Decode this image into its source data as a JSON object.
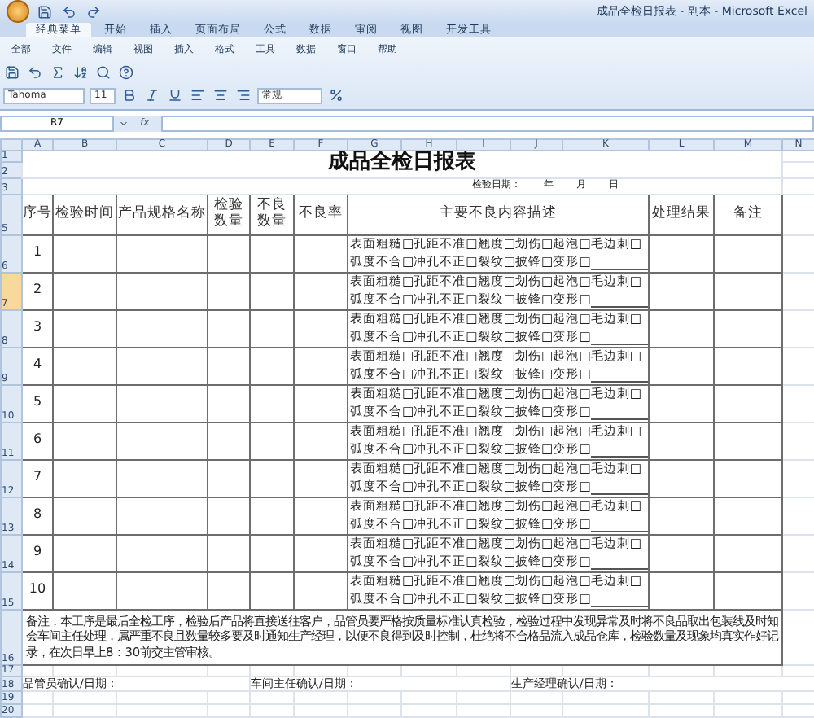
{
  "window": {
    "title": "成品全检日报表 - 副本 - Microsoft Excel"
  },
  "tabs": [
    {
      "label": "经典菜单",
      "selected": true
    },
    {
      "label": "开始",
      "selected": false
    },
    {
      "label": "插入",
      "selected": false
    },
    {
      "label": "页面布局",
      "selected": false
    },
    {
      "label": "公式",
      "selected": false
    },
    {
      "label": "数据",
      "selected": false
    },
    {
      "label": "审阅",
      "selected": false
    },
    {
      "label": "视图",
      "selected": false
    },
    {
      "label": "开发工具",
      "selected": false
    }
  ],
  "menu": [
    "全部",
    "文件",
    "编辑",
    "视图",
    "插入",
    "格式",
    "工具",
    "数据",
    "窗口",
    "帮助"
  ],
  "toolbar": {
    "font": "Tahoma",
    "size": "11",
    "number_format": "常规"
  },
  "formula_bar": {
    "name_box": "R7",
    "fx": "fx"
  },
  "columns": [
    "A",
    "B",
    "C",
    "D",
    "E",
    "F",
    "G",
    "H",
    "I",
    "J",
    "K",
    "L",
    "M",
    "N"
  ],
  "row_numbers": [
    {
      "label": "1",
      "selected": false
    },
    {
      "label": "2",
      "selected": false
    },
    {
      "label": "3",
      "selected": false
    },
    {
      "label": "5",
      "selected": false
    },
    {
      "label": "6",
      "selected": false
    },
    {
      "label": "7",
      "selected": true
    },
    {
      "label": "8",
      "selected": false
    },
    {
      "label": "9",
      "selected": false
    },
    {
      "label": "10",
      "selected": false
    },
    {
      "label": "11",
      "selected": false
    },
    {
      "label": "12",
      "selected": false
    },
    {
      "label": "13",
      "selected": false
    },
    {
      "label": "14",
      "selected": false
    },
    {
      "label": "15",
      "selected": false
    },
    {
      "label": "16",
      "selected": false
    },
    {
      "label": "17",
      "selected": false
    },
    {
      "label": "18",
      "selected": false
    },
    {
      "label": "19",
      "selected": false
    },
    {
      "label": "20",
      "selected": false
    }
  ],
  "sheet": {
    "title": "成品全检日报表",
    "date": [
      "检验日期：",
      "年",
      "月",
      "日"
    ],
    "headers": [
      "序号",
      "检验时间",
      "产品规格名称",
      "检验数量",
      "不良数量",
      "不良率",
      "主要不良内容描述",
      "处理结果",
      "备注"
    ],
    "rows": [
      {
        "no": "1",
        "defects": [
          "表面粗糙□孔距不准□翘度□划伤□起泡□毛边刺□",
          "弧度不合□冲孔不正□裂纹□披锋□变形□"
        ]
      },
      {
        "no": "2",
        "defects": [
          "表面粗糙□孔距不准□翘度□划伤□起泡□毛边刺□",
          "弧度不合□冲孔不正□裂纹□披锋□变形□"
        ]
      },
      {
        "no": "3",
        "defects": [
          "表面粗糙□孔距不准□翘度□划伤□起泡□毛边刺□",
          "弧度不合□冲孔不正□裂纹□披锋□变形□"
        ]
      },
      {
        "no": "4",
        "defects": [
          "表面粗糙□孔距不准□翘度□划伤□起泡□毛边刺□",
          "弧度不合□冲孔不正□裂纹□披锋□变形□"
        ]
      },
      {
        "no": "5",
        "defects": [
          "表面粗糙□孔距不准□翘度□划伤□起泡□毛边刺□",
          "弧度不合□冲孔不正□裂纹□披锋□变形□"
        ]
      },
      {
        "no": "6",
        "defects": [
          "表面粗糙□孔距不准□翘度□划伤□起泡□毛边刺□",
          "弧度不合□冲孔不正□裂纹□披锋□变形□"
        ]
      },
      {
        "no": "7",
        "defects": [
          "表面粗糙□孔距不准□翘度□划伤□起泡□毛边刺□",
          "弧度不合□冲孔不正□裂纹□披锋□变形□"
        ]
      },
      {
        "no": "8",
        "defects": [
          "表面粗糙□孔距不准□翘度□划伤□起泡□毛边刺□",
          "弧度不合□冲孔不正□裂纹□披锋□变形□"
        ]
      },
      {
        "no": "9",
        "defects": [
          "表面粗糙□孔距不准□翘度□划伤□起泡□毛边刺□",
          "弧度不合□冲孔不正□裂纹□披锋□变形□"
        ]
      },
      {
        "no": "10",
        "defects": [
          "表面粗糙□孔距不准□翘度□划伤□起泡□毛边刺□",
          "弧度不合□冲孔不正□裂纹□披锋□变形□"
        ]
      }
    ],
    "note": "备注，本工序是最后全检工序，检验后产品将直接送往客户，品管员要严格按质量标准认真检验，检验过程中发现异常及时将不良品取出包装线及时知会车间主任处理，属严重不良且数量较多要及时通知生产经理，以便不良得到及时控制，杜绝将不合格品流入成品仓库，检验数量及现象均真实作好记录，在次日早上8：30前交主管审核。",
    "signatures": [
      "品管员确认/日期：",
      "车间主任确认/日期：",
      "生产经理确认/日期："
    ]
  }
}
